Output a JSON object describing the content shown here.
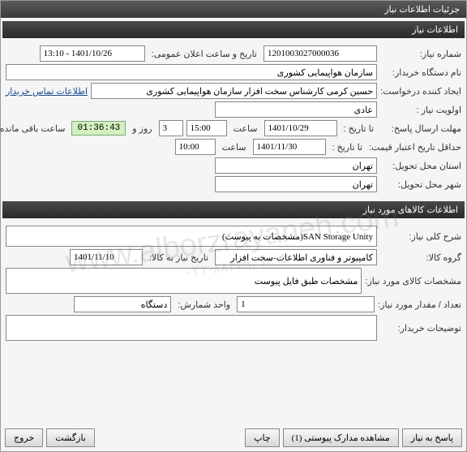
{
  "window": {
    "title": "جزئیات اطلاعات نیاز"
  },
  "section1": {
    "header": "اطلاعات نیاز",
    "need_no_label": "شماره نیاز:",
    "need_no": "1201003027000036",
    "announce_label": "تاریخ و ساعت اعلان عمومی:",
    "announce_value": "1401/10/26 - 13:10",
    "buyer_label": "نام دستگاه خریدار:",
    "buyer_value": "سازمان هواپیمایی کشوری",
    "creator_label": "ایجاد کننده درخواست:",
    "creator_value": "حسین کرمی کارشناس سخت افزار سازمان هواپیمایی کشوری",
    "contact_link": "اطلاعات تماس خریدار",
    "priority_label": "اولویت نیاز :",
    "priority_value": "عادی",
    "reply_deadline_label": "مهلت ارسال پاسخ:",
    "to_date_label": "تا تاریخ :",
    "reply_date": "1401/10/29",
    "time_label": "ساعت",
    "reply_time": "15:00",
    "days_value": "3",
    "days_and": "روز و",
    "countdown": "01:36:43",
    "remaining": "ساعت باقی مانده",
    "validity_label": "حداقل تاریخ اعتبار قیمت:",
    "validity_date": "1401/11/30",
    "validity_time": "10:00",
    "delivery_province_label": "استان محل تحویل:",
    "delivery_province": "تهران",
    "delivery_city_label": "شهر محل تحویل:",
    "delivery_city": "تهران"
  },
  "section2": {
    "header": "اطلاعات کالاهای مورد نیاز",
    "desc_label": "شرح کلی نیاز:",
    "desc_value": "SAN Storage Unity(مشخصات به پیوست)",
    "group_label": "گروه کالا:",
    "group_value": "کامپیوتر و فناوری اطلاعات-سخت افزار",
    "need_date_label": "تاریخ نیاز به کالا:",
    "need_date": "1401/11/10",
    "item_spec_label": "مشخصات کالای مورد نیاز:",
    "item_spec_value": "مشخصات طبق فایل پیوست",
    "qty_label": "تعداد / مقدار مورد نیاز:",
    "qty_value": "1",
    "unit_label": "واحد شمارش:",
    "unit_value": "دستگاه",
    "buyer_notes_label": "توضیحات خریدار:"
  },
  "footer": {
    "reply": "پاسخ به نیاز",
    "attachments": "مشاهده مدارک پیوستی (1)",
    "print": "چاپ",
    "back": "بازگشت",
    "exit": "خروج"
  },
  "watermark": {
    "main": "www.alborzrayaneh.com",
    "sub": "۰۲۱-۸۸۳۴۹۶۷۰-۵"
  }
}
